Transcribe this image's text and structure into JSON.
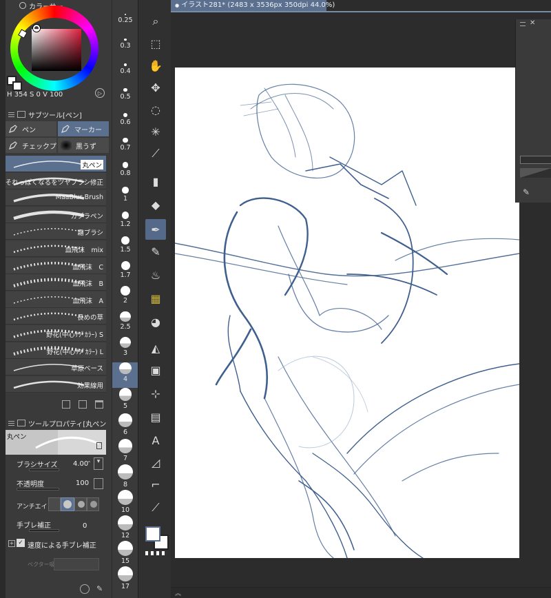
{
  "color_panel": {
    "title": "カラーサー",
    "h_label": "H",
    "h_value": "354",
    "s_label": "S",
    "s_value": "0",
    "v_label": "V",
    "v_value": "100",
    "main_color": "#ffffff",
    "sub_color": "#ffffff",
    "hue_color": "#e0203e"
  },
  "subtool": {
    "title": "サブツール[ペン]",
    "tabs": [
      {
        "label": "ペン"
      },
      {
        "label": "マーカー"
      },
      {
        "label": "チェックプ"
      },
      {
        "label": "黒うず"
      }
    ],
    "brushes": [
      {
        "label": "丸ペン"
      },
      {
        "label": "それっぽくなるをツヤブラシ修正"
      },
      {
        "label": "MaaBlur Brush"
      },
      {
        "label": "カブラペン"
      },
      {
        "label": "霜ブラシ"
      },
      {
        "label": "血飛沫　mix"
      },
      {
        "label": "血飛沫　C"
      },
      {
        "label": "血飛沫　B"
      },
      {
        "label": "血飛沫　A"
      },
      {
        "label": "長めの草"
      },
      {
        "label": "野花(中心ｻﾌﾞｶﾗｰ) S"
      },
      {
        "label": "野花(中心ｻﾌﾞｶﾗｰ) L"
      },
      {
        "label": "草原ベース"
      },
      {
        "label": "効果線用"
      }
    ]
  },
  "toolprop": {
    "title": "ツールプロパティ[丸ペン",
    "preview_label": "丸ペン",
    "brush_size_label": "ブラシサイズ",
    "brush_size_value": "4.00",
    "opacity_label": "不透明度",
    "opacity_value": "100",
    "antialias_label": "アンチエイリ",
    "stabilization_label": "手ブレ補正",
    "stabilization_value": "0",
    "speed_stab_label": "速度による手ブレ補正",
    "vector_label": "ベクター吸"
  },
  "sizes": [
    {
      "label": "0.25"
    },
    {
      "label": "0.3"
    },
    {
      "label": "0.4"
    },
    {
      "label": "0.5"
    },
    {
      "label": "0.6"
    },
    {
      "label": "0.7"
    },
    {
      "label": "0.8"
    },
    {
      "label": "1"
    },
    {
      "label": "1.2"
    },
    {
      "label": "1.5"
    },
    {
      "label": "1.7"
    },
    {
      "label": "2"
    },
    {
      "label": "2.5"
    },
    {
      "label": "3"
    },
    {
      "label": "4"
    },
    {
      "label": "5"
    },
    {
      "label": "6"
    },
    {
      "label": "7"
    },
    {
      "label": "8"
    },
    {
      "label": "10"
    },
    {
      "label": "12"
    },
    {
      "label": "15"
    },
    {
      "label": "17"
    }
  ],
  "tools": [
    {
      "name": "zoom-icon"
    },
    {
      "name": "object-icon"
    },
    {
      "name": "hand-icon"
    },
    {
      "name": "move-icon"
    },
    {
      "name": "lasso-icon"
    },
    {
      "name": "magic-wand-icon"
    },
    {
      "name": "eyedropper-icon"
    },
    {
      "name": "marker-icon"
    },
    {
      "name": "eraser-icon"
    },
    {
      "name": "pen-icon"
    },
    {
      "name": "pencil-icon"
    },
    {
      "name": "airbrush-icon"
    },
    {
      "name": "decoration-icon"
    },
    {
      "name": "blend-icon"
    },
    {
      "name": "fill-icon"
    },
    {
      "name": "gradient-icon"
    },
    {
      "name": "figure-icon"
    },
    {
      "name": "frame-icon"
    },
    {
      "name": "text-icon"
    },
    {
      "name": "balloon-icon"
    },
    {
      "name": "ruler-icon"
    },
    {
      "name": "line-correction-icon"
    }
  ],
  "document": {
    "tab_title": "イラスト281* (2483 x 3536px 350dpi 44.0%)"
  },
  "stroke_color": "#3f5f8f"
}
